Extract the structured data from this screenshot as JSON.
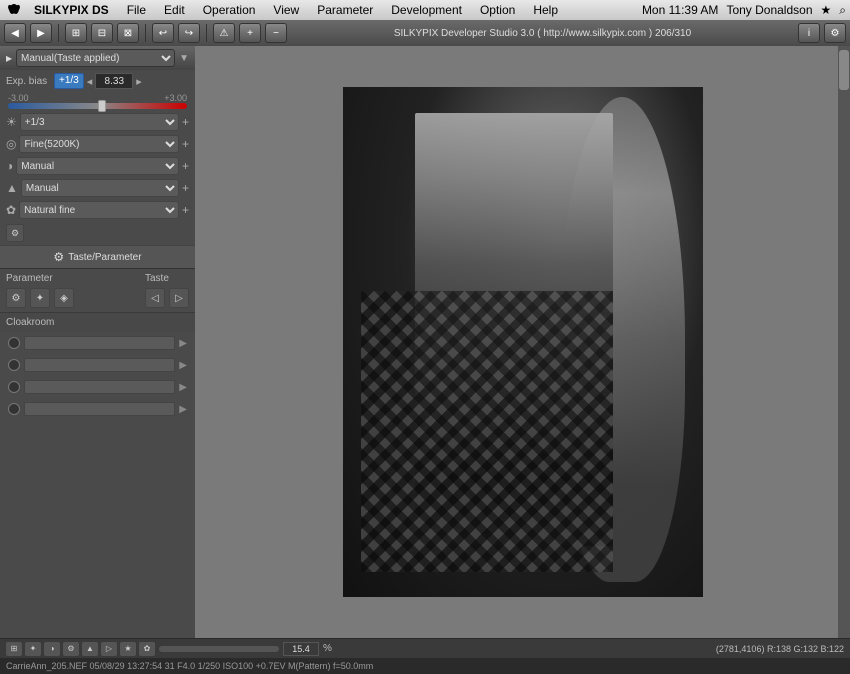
{
  "menubar": {
    "app_name": "SILKYPIX DS",
    "menus": [
      "File",
      "Edit",
      "Operation",
      "View",
      "Parameter",
      "Development",
      "Option",
      "Help"
    ],
    "time": "Mon 11:39 AM",
    "user": "Tony Donaldson"
  },
  "toolbar": {
    "title": "SILKYPIX Developer Studio 3.0 ( http://www.silkypix.com )  206/310"
  },
  "left_panel": {
    "preset_label": "Manual(Taste applied)",
    "exp_bias_label": "Exp. bias",
    "exp_value": "+1/3",
    "exp_number": "8.33",
    "slider_min": "-3.00",
    "slider_max": "+3.00",
    "dropdown1_value": "+1/3",
    "dropdown2_value": "Fine(5200K)",
    "dropdown3_value": "Manual",
    "dropdown4_value": "Manual",
    "dropdown5_value": "Natural fine",
    "taste_param_label": "Taste/Parameter",
    "param_label": "Parameter",
    "taste_label": "Taste",
    "cloakroom_label": "Cloakroom"
  },
  "bottom": {
    "zoom_value": "15.4",
    "zoom_pct": "%",
    "status": "CarrieAnn_205.NEF 05/08/29 13:27:54 31 F4.0 1/250 ISO100 +0.7EV M(Pattern) f=50.0mm",
    "coords": "(2781,4106) R:138 G:132 B:122"
  },
  "icons": {
    "gear": "⚙",
    "arrow_right": "▶",
    "arrow_left": "◀",
    "arrow_down": "▼",
    "plus": "+",
    "minus": "−",
    "check": "✓",
    "star": "★",
    "circle": "●",
    "triangle_right": "▸"
  }
}
